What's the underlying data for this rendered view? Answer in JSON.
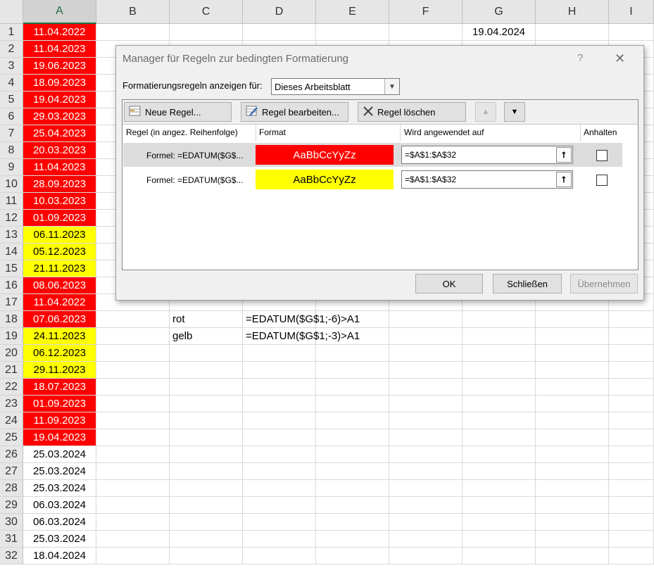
{
  "spreadsheet": {
    "columns": [
      "A",
      "B",
      "C",
      "D",
      "E",
      "F",
      "G",
      "H",
      "I"
    ],
    "selected_column": "A",
    "rows": [
      {
        "n": "1",
        "a": "11.04.2022",
        "fill": "red",
        "g": "19.04.2024"
      },
      {
        "n": "2",
        "a": "11.04.2023",
        "fill": "red"
      },
      {
        "n": "3",
        "a": "19.06.2023",
        "fill": "red"
      },
      {
        "n": "4",
        "a": "18.09.2023",
        "fill": "red"
      },
      {
        "n": "5",
        "a": "19.04.2023",
        "fill": "red"
      },
      {
        "n": "6",
        "a": "29.03.2023",
        "fill": "red"
      },
      {
        "n": "7",
        "a": "25.04.2023",
        "fill": "red"
      },
      {
        "n": "8",
        "a": "20.03.2023",
        "fill": "red"
      },
      {
        "n": "9",
        "a": "11.04.2023",
        "fill": "red"
      },
      {
        "n": "10",
        "a": "28.09.2023",
        "fill": "red"
      },
      {
        "n": "11",
        "a": "10.03.2023",
        "fill": "red"
      },
      {
        "n": "12",
        "a": "01.09.2023",
        "fill": "red"
      },
      {
        "n": "13",
        "a": "06.11.2023",
        "fill": "yellow"
      },
      {
        "n": "14",
        "a": "05.12.2023",
        "fill": "yellow"
      },
      {
        "n": "15",
        "a": "21.11.2023",
        "fill": "yellow"
      },
      {
        "n": "16",
        "a": "08.06.2023",
        "fill": "red"
      },
      {
        "n": "17",
        "a": "11.04.2022",
        "fill": "red"
      },
      {
        "n": "18",
        "a": "07.06.2023",
        "fill": "red",
        "c": "rot",
        "d": "=EDATUM($G$1;-6)>A1"
      },
      {
        "n": "19",
        "a": "24.11.2023",
        "fill": "yellow",
        "c": "gelb",
        "d": "=EDATUM($G$1;-3)>A1"
      },
      {
        "n": "20",
        "a": "06.12.2023",
        "fill": "yellow"
      },
      {
        "n": "21",
        "a": "29.11.2023",
        "fill": "yellow"
      },
      {
        "n": "22",
        "a": "18.07.2023",
        "fill": "red"
      },
      {
        "n": "23",
        "a": "01.09.2023",
        "fill": "red"
      },
      {
        "n": "24",
        "a": "11.09.2023",
        "fill": "red"
      },
      {
        "n": "25",
        "a": "19.04.2023",
        "fill": "red"
      },
      {
        "n": "26",
        "a": "25.03.2024",
        "fill": "none"
      },
      {
        "n": "27",
        "a": "25.03.2024",
        "fill": "none"
      },
      {
        "n": "28",
        "a": "25.03.2024",
        "fill": "none"
      },
      {
        "n": "29",
        "a": "06.03.2024",
        "fill": "none"
      },
      {
        "n": "30",
        "a": "06.03.2024",
        "fill": "none"
      },
      {
        "n": "31",
        "a": "25.03.2024",
        "fill": "none"
      },
      {
        "n": "32",
        "a": "18.04.2024",
        "fill": "none"
      }
    ]
  },
  "dialog": {
    "title": "Manager für Regeln zur bedingten Formatierung",
    "help": "?",
    "close": "✕",
    "show_rules_label": "Formatierungsregeln anzeigen für:",
    "show_rules_value": "Dieses Arbeitsblatt",
    "toolbar": {
      "new_rule": "Neue Regel...",
      "edit_rule": "Regel bearbeiten...",
      "delete_rule": "Regel löschen"
    },
    "headers": {
      "rule": "Regel (in angez. Reihenfolge)",
      "format": "Format",
      "applies_to": "Wird angewendet auf",
      "stop": "Anhalten"
    },
    "rules": [
      {
        "formula": "Formel: =EDATUM($G$...",
        "preview": "AaBbCcYyZz",
        "color": "red",
        "range": "=$A$1:$A$32",
        "stop": false
      },
      {
        "formula": "Formel: =EDATUM($G$...",
        "preview": "AaBbCcYyZz",
        "color": "yellow",
        "range": "=$A$1:$A$32",
        "stop": false
      }
    ],
    "buttons": {
      "ok": "OK",
      "close": "Schließen",
      "apply": "Übernehmen"
    }
  },
  "colors": {
    "red": "#ff0000",
    "yellow": "#ffff00",
    "header_bg": "#e6e6e6",
    "dialog_bg": "#f0f0f0"
  }
}
